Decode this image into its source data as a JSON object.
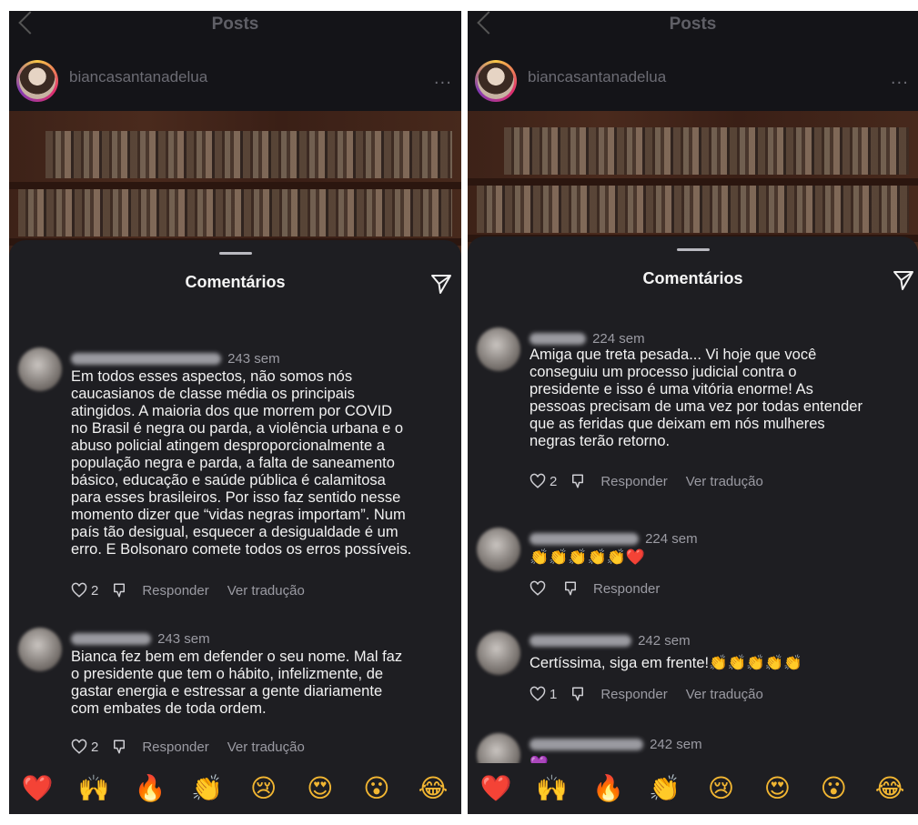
{
  "left": {
    "header_title": "Posts",
    "username": "biancasantanadelua",
    "more": "...",
    "sheet_title": "Comentários",
    "comments": [
      {
        "time": "243 sem",
        "text": "Em todos esses aspectos, não somos nós\ncaucasianos de classe média os principais\natingidos. A maioria dos que morrem por COVID\nno Brasil é negra ou parda, a violência urbana e o\nabuso policial atingem desproporcionalmente a\npopulação negra e parda, a falta de saneamento\nbásico, educação e saúde pública é calamitosa\npara esses brasileiros. Por isso faz sentido nesse\nmomento dizer que “vidas negras importam”. Num\npaís tão desigual, esquecer a desigualdade é um\nerro. E Bolsonaro comete todos os erros possíveis.",
        "likes": "2",
        "reply": "Responder",
        "translate": "Ver tradução"
      },
      {
        "time": "243 sem",
        "text": "Bianca fez bem em defender o seu nome. Mal faz\no presidente que tem o hábito, infelizmente, de\ngastar energia e estressar a gente diariamente\ncom embates de toda ordem.",
        "likes": "2",
        "reply": "Responder",
        "translate": "Ver tradução"
      }
    ]
  },
  "right": {
    "header_title": "Posts",
    "username": "biancasantanadelua",
    "more": "...",
    "sheet_title": "Comentários",
    "comments": [
      {
        "time": "224 sem",
        "text": "Amiga que treta pesada... Vi hoje que você\nconseguiu um processo judicial contra o\npresidente e isso é uma vitória enorme! As\npessoas precisam de uma vez por todas entender\nque as feridas que deixam em nós mulheres\nnegras terão retorno.",
        "likes": "2",
        "reply": "Responder",
        "translate": "Ver tradução"
      },
      {
        "time": "224 sem",
        "text": "👏👏👏👏👏❤️",
        "reply": "Responder"
      },
      {
        "time": "242 sem",
        "text": "Certíssima, siga em frente!👏👏👏👏👏",
        "likes": "1",
        "reply": "Responder",
        "translate": "Ver tradução"
      },
      {
        "time": "242 sem",
        "text": "💜"
      }
    ]
  },
  "reaction_bar": [
    "❤️",
    "🙌",
    "🔥",
    "👏",
    "😢",
    "😍",
    "😮",
    "😂"
  ],
  "colors": {
    "sheet_bg": "#1e1e22",
    "text": "#f2f2f2",
    "secondary": "#9b9ba3",
    "heart": "#e02a3c"
  }
}
